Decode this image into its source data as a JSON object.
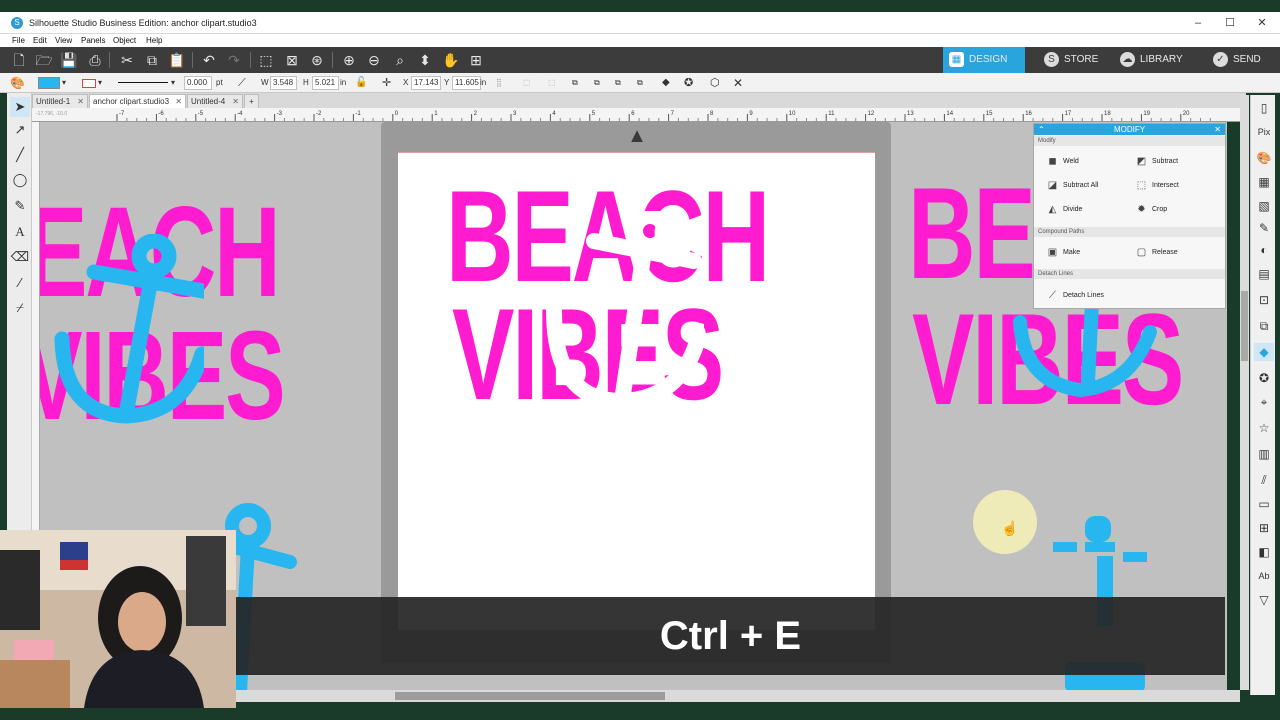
{
  "window": {
    "title": "Silhouette Studio Business Edition: anchor clipart.studio3",
    "controls": [
      "–",
      "☐",
      "✕"
    ]
  },
  "menu": [
    "File",
    "Edit",
    "View",
    "Panels",
    "Object",
    "Help"
  ],
  "nav_tabs": [
    {
      "label": "DESIGN",
      "icon": "grid-icon",
      "active": true
    },
    {
      "label": "STORE",
      "icon": "store-icon",
      "active": false
    },
    {
      "label": "LIBRARY",
      "icon": "cloud-library-icon",
      "active": false
    },
    {
      "label": "SEND",
      "icon": "send-check-icon",
      "active": false
    }
  ],
  "properties": {
    "fill_color": "#27B6F0",
    "line_width": "0.000",
    "line_unit": "pt",
    "w_label": "W",
    "w_value": "3.548",
    "h_label": "H",
    "h_value": "5.021",
    "size_unit": "in",
    "x_label": "X",
    "x_value": "17.143",
    "y_label": "Y",
    "y_value": "11.605",
    "pos_unit": "in"
  },
  "doc_tabs": [
    {
      "label": "Untitled-1",
      "active": false
    },
    {
      "label": "anchor clipart.studio3",
      "active": true
    },
    {
      "label": "Untitled-4",
      "active": false
    }
  ],
  "ruler": {
    "ticks": [
      "-7",
      "-6",
      "-5",
      "-4",
      "-3",
      "-2",
      "-1",
      "0",
      "1",
      "2",
      "3",
      "4",
      "5",
      "6",
      "7",
      "8",
      "9",
      "10",
      "11",
      "12",
      "13",
      "14",
      "15",
      "16",
      "17",
      "18",
      "19",
      "20"
    ],
    "corner_readout": "-17.796, -10.0"
  },
  "canvas": {
    "left_text": [
      "EACH",
      "VIBES"
    ],
    "center_text": [
      "BEACH",
      "VIBES"
    ],
    "right_text": [
      "BE",
      "VIBES"
    ]
  },
  "modify_panel": {
    "title": "MODIFY",
    "sections": [
      {
        "label": "Modify",
        "buttons": [
          {
            "label": "Weld",
            "icon": "weld-icon"
          },
          {
            "label": "Subtract",
            "icon": "subtract-icon"
          },
          {
            "label": "Subtract All",
            "icon": "subtract-all-icon"
          },
          {
            "label": "Intersect",
            "icon": "intersect-icon"
          },
          {
            "label": "Divide",
            "icon": "divide-icon"
          },
          {
            "label": "Crop",
            "icon": "crop-icon"
          }
        ]
      },
      {
        "label": "Compound Paths",
        "buttons": [
          {
            "label": "Make",
            "icon": "make-compound-icon"
          },
          {
            "label": "Release",
            "icon": "release-compound-icon"
          }
        ]
      },
      {
        "label": "Detach Lines",
        "buttons": [
          {
            "label": "Detach Lines",
            "icon": "detach-lines-icon"
          }
        ]
      }
    ]
  },
  "caption": {
    "text": "Ctrl + E"
  },
  "colors": {
    "accent": "#2AA4DC",
    "pink_text": "#FF1BD0",
    "anchor_blue": "#27B6F0"
  }
}
